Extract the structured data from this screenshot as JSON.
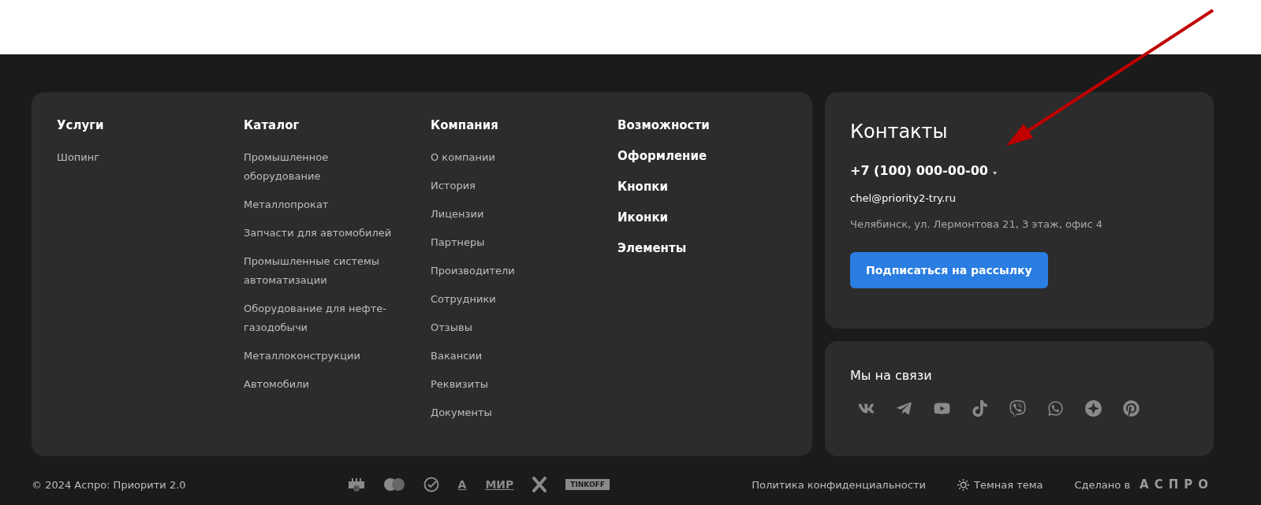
{
  "menu_columns": [
    {
      "title": "Услуги",
      "kind": "plain",
      "items": [
        "Шопинг"
      ]
    },
    {
      "title": "Каталог",
      "kind": "plain",
      "items": [
        "Промышленное оборудование",
        "Металлопрокат",
        "Запчасти для автомобилей",
        "Промышленные системы автоматизации",
        "Оборудование для нефте-газодобычи",
        "Металлоконструкции",
        "Автомобили"
      ]
    },
    {
      "title": "Компания",
      "kind": "plain",
      "items": [
        "О компании",
        "История",
        "Лицензии",
        "Партнеры",
        "Производители",
        "Сотрудники",
        "Отзывы",
        "Вакансии",
        "Реквизиты",
        "Документы"
      ]
    },
    {
      "title": "Возможности",
      "kind": "bold",
      "items": [
        "Оформление",
        "Кнопки",
        "Иконки",
        "Элементы"
      ]
    }
  ],
  "contacts": {
    "title": "Контакты",
    "phone": "+7 (100) 000-00-00",
    "email": "chel@priority2-try.ru",
    "address": "Челябинск, ул. Лермонтова 21, 3 этаж, офис 4",
    "button": "Подписаться на рассылку"
  },
  "social": {
    "title": "Мы на связи",
    "networks": [
      {
        "kind": "vk"
      },
      {
        "kind": "telegram"
      },
      {
        "kind": "youtube"
      },
      {
        "kind": "tiktok"
      },
      {
        "kind": "viber"
      },
      {
        "kind": "whatsapp"
      },
      {
        "kind": "star"
      },
      {
        "kind": "pinterest"
      }
    ]
  },
  "bottom_bar": {
    "copyright": "© 2024 Аспро: Приорити 2.0",
    "payments": [
      {
        "kind": "icon-card"
      },
      {
        "kind": "icon-circles"
      },
      {
        "kind": "icon-check"
      },
      {
        "kind": "text",
        "text": "А"
      },
      {
        "kind": "text",
        "text": "МИР"
      },
      {
        "kind": "icon-x"
      },
      {
        "kind": "tag",
        "text": "TINKOFF"
      }
    ],
    "privacy": "Политика конфиденциальности",
    "theme": "Темная тема",
    "made_by": "Сделано в",
    "made_by_logo": "АСПРО"
  }
}
